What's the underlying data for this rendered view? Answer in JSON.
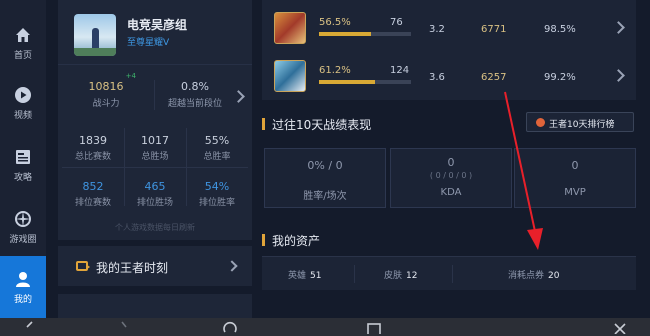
{
  "rail": {
    "items": [
      {
        "label": "首页"
      },
      {
        "label": "视频"
      },
      {
        "label": "攻略"
      },
      {
        "label": "游戏圈"
      },
      {
        "label": "我的"
      }
    ]
  },
  "profile": {
    "name": "电竞吴彦组",
    "rank": "至尊星耀V",
    "power_value": "10816",
    "power_delta": "+4",
    "power_label": "战斗力",
    "exceed_value": "0.8%",
    "exceed_label": "超越当前段位",
    "stats": [
      {
        "value": "1839",
        "label": "总比赛数"
      },
      {
        "value": "1017",
        "label": "总胜场"
      },
      {
        "value": "55%",
        "label": "总胜率"
      },
      {
        "value": "852",
        "label": "排位赛数"
      },
      {
        "value": "465",
        "label": "排位胜场"
      },
      {
        "value": "54%",
        "label": "排位胜率"
      }
    ],
    "footer": "个人游戏数据每日刷新"
  },
  "moment": {
    "label": "我的王者时刻"
  },
  "heroes": [
    {
      "win_pct": "56.5%",
      "win_fraction": 0.565,
      "games": "76",
      "kda": "3.2",
      "score": "6771",
      "rate": "98.5%"
    },
    {
      "win_pct": "61.2%",
      "win_fraction": 0.612,
      "games": "124",
      "kda": "3.6",
      "score": "6257",
      "rate": "99.2%"
    }
  ],
  "recent": {
    "title": "过往10天战绩表现",
    "rank_button": "王者10天排行榜",
    "boxes": [
      {
        "value": "0% / 0",
        "sub": "",
        "label": "胜率/场次"
      },
      {
        "value": "0",
        "sub": "( 0 / 0 / 0 )",
        "label": "KDA"
      },
      {
        "value": "0",
        "sub": "",
        "label": "MVP"
      }
    ]
  },
  "assets": {
    "title": "我的资产",
    "items": [
      {
        "label": "英雄",
        "value": "51"
      },
      {
        "label": "皮肤",
        "value": "12"
      },
      {
        "label": "消耗点券",
        "value": "20"
      }
    ]
  },
  "colors": {
    "accent": "#1677d9",
    "gold": "#d9c184",
    "orange": "#e0a43a",
    "arrow": "#e8202a"
  }
}
